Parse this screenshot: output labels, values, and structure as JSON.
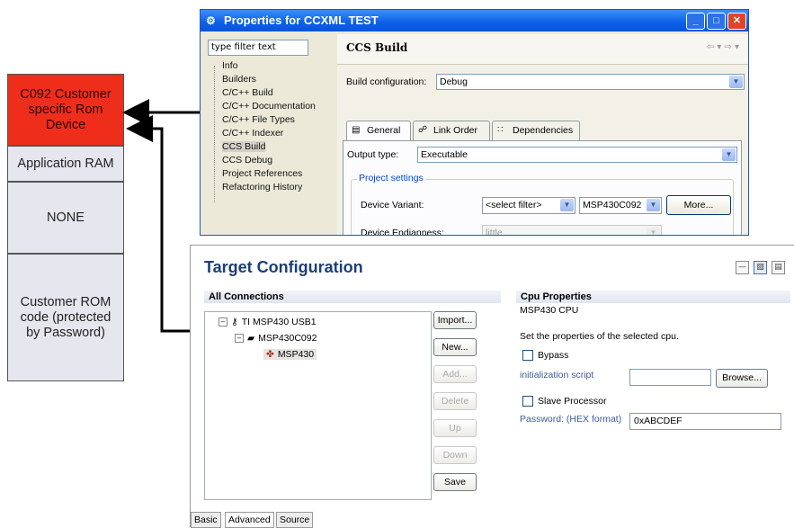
{
  "memory_map": {
    "blocks": [
      {
        "label": "C092 Customer specific Rom Device"
      },
      {
        "label": "Application RAM"
      },
      {
        "label": "NONE"
      },
      {
        "label": "Customer ROM code (protected by Password)"
      }
    ],
    "colors": {
      "highlight": "#ee2e1b",
      "block": "#e6e6ef"
    }
  },
  "properties_window": {
    "title": "Properties for CCXML TEST",
    "filter_placeholder": "type filter text",
    "tree": [
      "Info",
      "Builders",
      "C/C++ Build",
      "C/C++ Documentation",
      "C/C++ File Types",
      "C/C++ Indexer",
      "CCS Build",
      "CCS Debug",
      "Project References",
      "Refactoring History"
    ],
    "selected_item": "CCS Build",
    "panel_title": "CCS Build",
    "build_config_label": "Build configuration:",
    "build_config_value": "Debug",
    "tabs": [
      {
        "label": "General",
        "icon": "general-icon"
      },
      {
        "label": "Link Order",
        "icon": "link-order-icon"
      },
      {
        "label": "Dependencies",
        "icon": "dependencies-icon"
      }
    ],
    "output_type_label": "Output type:",
    "output_type_value": "Executable",
    "project_settings_title": "Project settings",
    "device_variant_label": "Device Variant:",
    "device_variant_filter": "<select filter>",
    "device_variant_value": "MSP430C092",
    "more_button": "More...",
    "device_endianness_label": "Device Endianness:",
    "device_endianness_value": "little"
  },
  "target_config": {
    "title": "Target Configuration",
    "all_connections": "All Connections",
    "tree": {
      "root": "TI MSP430 USB1",
      "child": "MSP430C092",
      "leaf": "MSP430"
    },
    "buttons": {
      "import": "Import...",
      "new": "New...",
      "add": "Add...",
      "delete": "Delete",
      "up": "Up",
      "down": "Down",
      "save": "Save"
    },
    "cpu_properties": {
      "header": "Cpu Properties",
      "cpu_name": "MSP430 CPU",
      "description": "Set the properties of the selected cpu.",
      "bypass_label": "Bypass",
      "init_script_label": "initialization script",
      "init_script_value": "",
      "browse_button": "Browse...",
      "slave_label": "Slave Processor",
      "password_label": "Password: (HEX format)",
      "password_value": "0xABCDEF"
    },
    "bottom_tabs": [
      "Basic",
      "Advanced",
      "Source"
    ],
    "active_bottom_tab": "Advanced"
  }
}
